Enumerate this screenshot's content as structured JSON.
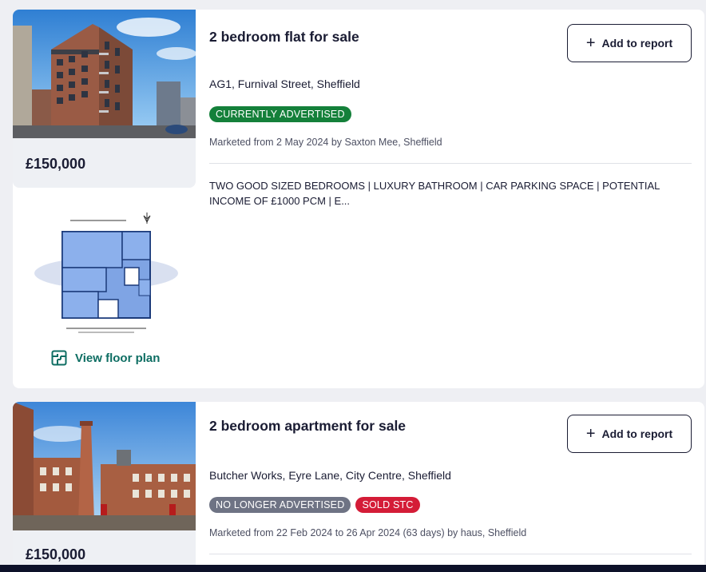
{
  "listings": [
    {
      "title": "2 bedroom flat for sale",
      "address": "AG1, Furnival Street, Sheffield",
      "price": "£150,000",
      "add_button": "Add to report",
      "badges": [
        "CURRENTLY ADVERTISED"
      ],
      "marketed": "Marketed from 2 May 2024 by Saxton Mee, Sheffield",
      "summary": "TWO GOOD SIZED BEDROOMS | LUXURY BATHROOM | CAR PARKING SPACE | POTENTIAL INCOME OF £1000 PCM | E...",
      "floor_plan_link": "View floor plan"
    },
    {
      "title": "2 bedroom apartment for sale",
      "address": "Butcher Works, Eyre Lane, City Centre, Sheffield",
      "price": "£150,000",
      "add_button": "Add to report",
      "badges": [
        "NO LONGER ADVERTISED",
        "SOLD STC"
      ],
      "marketed": "Marketed from 22 Feb 2024 to 26 Apr 2024 (63 days) by haus, Sheffield"
    }
  ],
  "colors": {
    "advertised": "#14803a",
    "no_longer": "#6e7384",
    "sold_stc": "#d41c37",
    "link": "#0e6e63",
    "text": "#1a1c33"
  },
  "icons": [
    "plus-icon",
    "floor-plan-icon"
  ]
}
